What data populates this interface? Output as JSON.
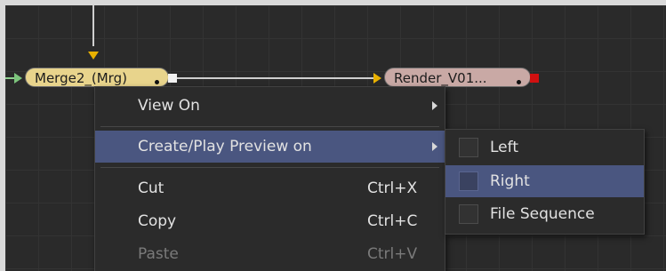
{
  "nodes": {
    "merge": {
      "label": "Merge2_(Mrg)"
    },
    "render": {
      "label": "Render_V01..."
    }
  },
  "context_menu": {
    "items": [
      {
        "label": "View On",
        "shortcut": ""
      },
      {
        "label": "Create/Play Preview on",
        "shortcut": ""
      },
      {
        "label": "Cut",
        "shortcut": "Ctrl+X"
      },
      {
        "label": "Copy",
        "shortcut": "Ctrl+C"
      },
      {
        "label": "Paste",
        "shortcut": "Ctrl+V"
      }
    ]
  },
  "submenu": {
    "items": [
      {
        "label": "Left"
      },
      {
        "label": "Right"
      },
      {
        "label": "File Sequence"
      }
    ]
  },
  "colors": {
    "selection": "#4a5680",
    "merge_node": "#e8d48c",
    "render_node": "#c9a9a5",
    "input_arrow": "#e8b000",
    "output_red": "#d01010"
  }
}
